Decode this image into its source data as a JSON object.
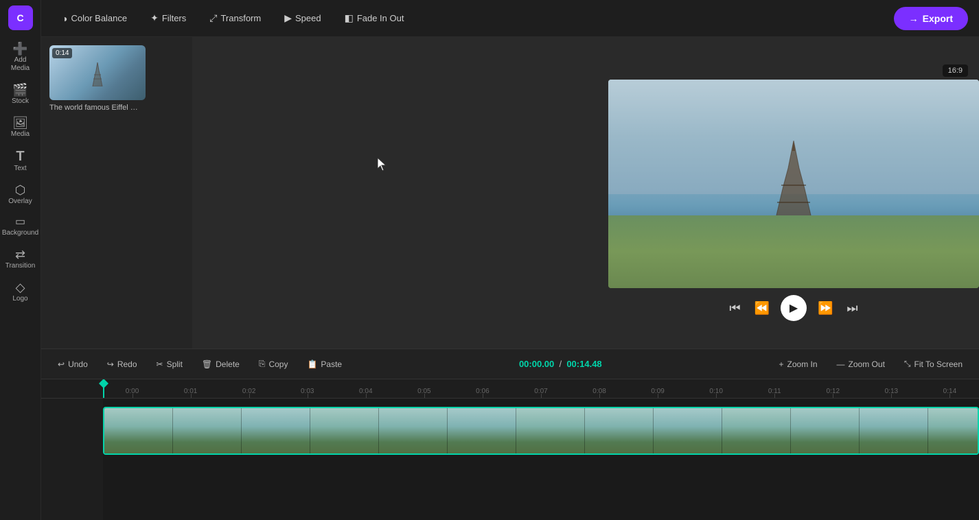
{
  "app": {
    "logo_letter": "C",
    "logo_bg": "#7b2fff"
  },
  "sidebar": {
    "items": [
      {
        "id": "add-media",
        "icon": "➕",
        "label": "Add Media"
      },
      {
        "id": "stock",
        "icon": "🎬",
        "label": "Stock"
      },
      {
        "id": "media",
        "icon": "🖼",
        "label": "Media"
      },
      {
        "id": "text",
        "icon": "T",
        "label": "Text"
      },
      {
        "id": "overlay",
        "icon": "⬡",
        "label": "Overlay"
      },
      {
        "id": "background",
        "icon": "▭",
        "label": "Background"
      },
      {
        "id": "transition",
        "icon": "⇄",
        "label": "Transition"
      },
      {
        "id": "logo",
        "icon": "◇",
        "label": "Logo"
      }
    ]
  },
  "top_toolbar": {
    "color_balance_label": "Color Balance",
    "filters_label": "Filters",
    "transform_label": "Transform",
    "speed_label": "Speed",
    "fade_in_out_label": "Fade In Out",
    "export_label": "Export"
  },
  "preview": {
    "aspect_ratio": "16:9"
  },
  "media_panel": {
    "thumbnail_badge": "0:14",
    "thumbnail_title": "The world famous Eiffel …"
  },
  "timeline": {
    "undo_label": "Undo",
    "redo_label": "Redo",
    "split_label": "Split",
    "delete_label": "Delete",
    "copy_label": "Copy",
    "paste_label": "Paste",
    "zoom_in_label": "Zoom In",
    "zoom_out_label": "Zoom Out",
    "fit_to_screen_label": "Fit To Screen",
    "current_time": "00:00",
    "current_time_frames": ".00",
    "total_time": "00:14",
    "total_time_frames": ".48",
    "ruler_marks": [
      "0:00",
      "0:01",
      "0:02",
      "0:03",
      "0:04",
      "0:05",
      "0:06",
      "0:07",
      "0:08",
      "0:09",
      "0:10",
      "0:11",
      "0:12",
      "0:13",
      "0:14"
    ]
  }
}
